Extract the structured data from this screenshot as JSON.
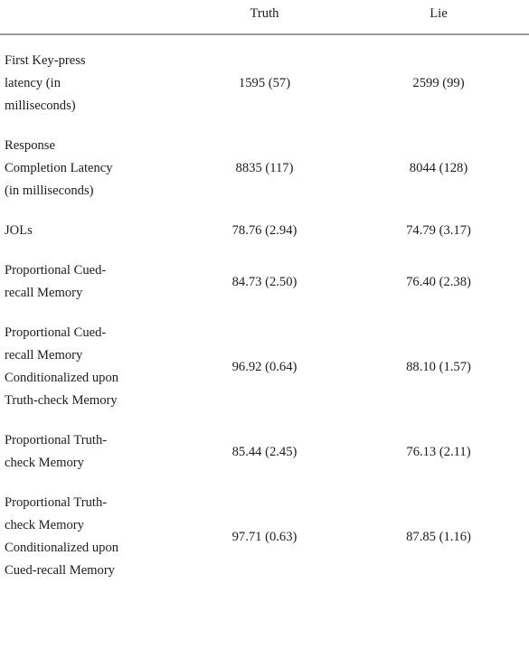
{
  "table": {
    "columns": [
      {
        "key": "measure",
        "header": ""
      },
      {
        "key": "truth",
        "header": "Truth"
      },
      {
        "key": "lie",
        "header": "Lie"
      }
    ],
    "rule_color": "#9a9a9a",
    "text_color": "#1c1c1c",
    "background_color": "#ffffff",
    "rows": [
      {
        "label": "First Key-press latency (in milliseconds)",
        "label_lines": [
          "First Key-press",
          "latency (in",
          "milliseconds)"
        ],
        "truth": "1595 (57)",
        "lie": "2599 (99)"
      },
      {
        "label": "Response Completion Latency (in milliseconds)",
        "label_lines": [
          "Response",
          "Completion Latency",
          "(in milliseconds)"
        ],
        "truth": "8835 (117)",
        "lie": "8044 (128)"
      },
      {
        "label": "JOLs",
        "label_lines": [
          "JOLs"
        ],
        "truth": "78.76 (2.94)",
        "lie": "74.79 (3.17)"
      },
      {
        "label": "Proportional Cued-recall Memory",
        "label_lines": [
          "Proportional Cued-",
          "recall Memory"
        ],
        "truth": "84.73 (2.50)",
        "lie": "76.40 (2.38)"
      },
      {
        "label": "Proportional Cued-recall Memory Conditionalized upon Truth-check Memory",
        "label_lines": [
          "Proportional Cued-",
          "recall Memory",
          "Conditionalized upon",
          "Truth-check Memory"
        ],
        "truth": "96.92 (0.64)",
        "lie": "88.10 (1.57)"
      },
      {
        "label": "Proportional Truth-check Memory",
        "label_lines": [
          "Proportional Truth-",
          "check Memory"
        ],
        "truth": "85.44 (2.45)",
        "lie": "76.13 (2.11)"
      },
      {
        "label": "Proportional Truth-check Memory Conditionalized upon Cued-recall Memory",
        "label_lines": [
          "Proportional Truth-",
          "check Memory",
          "Conditionalized upon",
          "Cued-recall Memory"
        ],
        "truth": "97.71 (0.63)",
        "lie": "87.85 (1.16)"
      }
    ]
  }
}
